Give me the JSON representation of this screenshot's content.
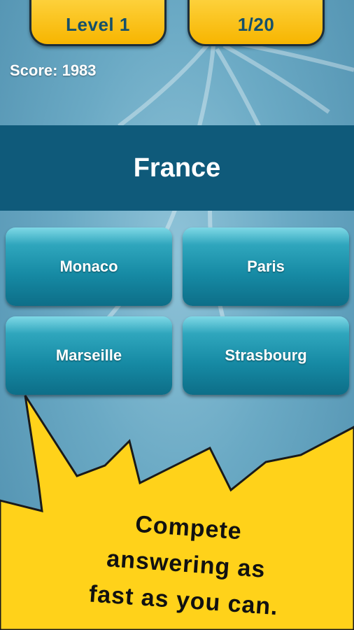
{
  "header": {
    "level_label": "Level 1",
    "progress_label": "1/20"
  },
  "score_label": "Score: 1983",
  "question": {
    "country": "France"
  },
  "answers": [
    {
      "label": "Monaco"
    },
    {
      "label": "Paris"
    },
    {
      "label": "Marseille"
    },
    {
      "label": "Strasbourg"
    }
  ],
  "promo": {
    "line1": "Compete",
    "line2": "answering as",
    "line3": "fast as you can."
  },
  "colors": {
    "pill": "#f7b500",
    "banner": "#0f5a7a",
    "answer": "#168aa4",
    "burst": "#ffd21a"
  }
}
